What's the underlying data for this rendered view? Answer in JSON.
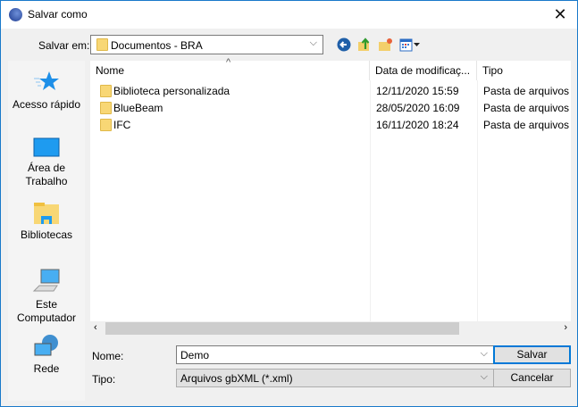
{
  "window": {
    "title": "Salvar como",
    "close": "✕"
  },
  "toolbar": {
    "save_in_label": "Salvar em:",
    "location": "Documentos - BRA"
  },
  "places": [
    {
      "label1": "Acesso rápido",
      "label2": ""
    },
    {
      "label1": "Área de",
      "label2": "Trabalho"
    },
    {
      "label1": "Bibliotecas",
      "label2": ""
    },
    {
      "label1": "Este",
      "label2": "Computador"
    },
    {
      "label1": "Rede",
      "label2": ""
    }
  ],
  "columns": {
    "name": "Nome",
    "date": "Data de modificaç...",
    "type": "Tipo"
  },
  "files": [
    {
      "name": "Biblioteca personalizada",
      "date": "12/11/2020 15:59",
      "type": "Pasta de arquivos"
    },
    {
      "name": "BlueBeam",
      "date": "28/05/2020 16:09",
      "type": "Pasta de arquivos"
    },
    {
      "name": "IFC",
      "date": "16/11/2020 18:24",
      "type": "Pasta de arquivos"
    }
  ],
  "form": {
    "name_label": "Nome:",
    "name_value": "Demo",
    "type_label": "Tipo:",
    "type_value": "Arquivos gbXML (*.xml)",
    "save": "Salvar",
    "cancel": "Cancelar"
  }
}
